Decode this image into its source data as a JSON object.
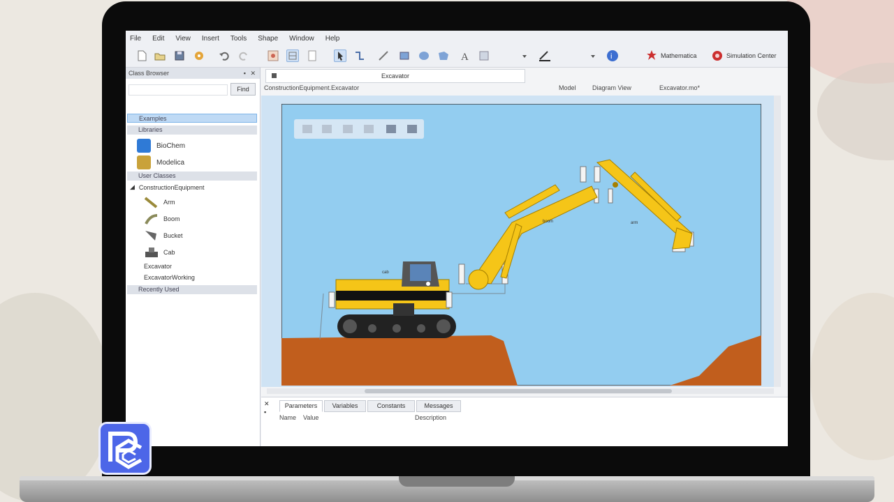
{
  "menu": [
    "File",
    "Edit",
    "View",
    "Insert",
    "Tools",
    "Shape",
    "Window",
    "Help"
  ],
  "toolbar": {
    "mathematica_label": "Mathematica",
    "simulation_center_label": "Simulation Center"
  },
  "class_browser": {
    "title": "Class Browser",
    "find_label": "Find",
    "sections": {
      "examples": "Examples",
      "libraries": "Libraries",
      "user_classes": "User Classes",
      "recently_used": "Recently Used"
    },
    "libraries": [
      "BioChem",
      "Modelica"
    ],
    "package": "ConstructionEquipment",
    "classes": [
      "Arm",
      "Boom",
      "Bucket",
      "Cab",
      "Excavator",
      "ExcavatorWorking"
    ]
  },
  "document": {
    "tab_title": "Excavator",
    "path": "ConstructionEquipment.Excavator",
    "view_model": "Model",
    "view_diagram": "Diagram View",
    "file_name": "Excavator.mo*"
  },
  "diagram": {
    "label_cab": "cab",
    "label_boom": "boom",
    "label_arm": "arm"
  },
  "bottom_panel": {
    "tabs": [
      "Parameters",
      "Variables",
      "Constants",
      "Messages"
    ],
    "columns": [
      "Name",
      "Value",
      "Description"
    ]
  },
  "colors": {
    "sky": "#93cdf0",
    "ground": "#c15e1d",
    "machine_yellow": "#f5c518",
    "logo_blue": "#4d66e8"
  }
}
